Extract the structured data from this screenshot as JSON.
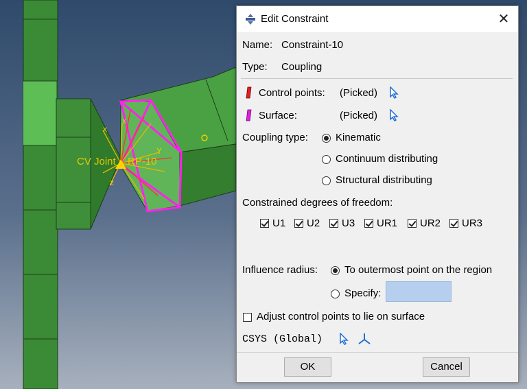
{
  "viewport": {
    "labels": {
      "cv_joint": "CV Joint",
      "rp": "RP-10"
    },
    "colors": {
      "part_green": "#3f8f3a",
      "highlight": "#ff22ee",
      "rp_label": "#e8c800"
    }
  },
  "dialog": {
    "title": "Edit Constraint",
    "close_label": "✕",
    "name_label": "Name:",
    "name_value": "Constraint-10",
    "type_label": "Type:",
    "type_value": "Coupling",
    "control_points_label": "Control points:",
    "control_points_value": "(Picked)",
    "surface_label": "Surface:",
    "surface_value": "(Picked)",
    "coupling_type_label": "Coupling type:",
    "coupling_options": [
      "Kinematic",
      "Continuum distributing",
      "Structural distributing"
    ],
    "coupling_selected": "Kinematic",
    "dof_label": "Constrained degrees of freedom:",
    "dofs": [
      {
        "label": "U1",
        "checked": true
      },
      {
        "label": "U2",
        "checked": true
      },
      {
        "label": "U3",
        "checked": true
      },
      {
        "label": "UR1",
        "checked": true
      },
      {
        "label": "UR2",
        "checked": true
      },
      {
        "label": "UR3",
        "checked": true
      }
    ],
    "influence_label": "Influence radius:",
    "influence_option_outermost": "To outermost point on the region",
    "influence_option_specify": "Specify:",
    "influence_selected": "To outermost point on the region",
    "specify_value": "",
    "adjust_label": "Adjust control points to lie on surface",
    "adjust_checked": false,
    "csys_label": "CSYS (Global)",
    "ok_label": "OK",
    "cancel_label": "Cancel"
  },
  "icons": {
    "title": "constraint-icon",
    "control_points": "red-marker-icon",
    "surface": "magenta-marker-icon",
    "pick": "arrow-cursor-icon",
    "csys_pick": "arrow-cursor-icon",
    "csys_create": "triad-axes-icon"
  }
}
